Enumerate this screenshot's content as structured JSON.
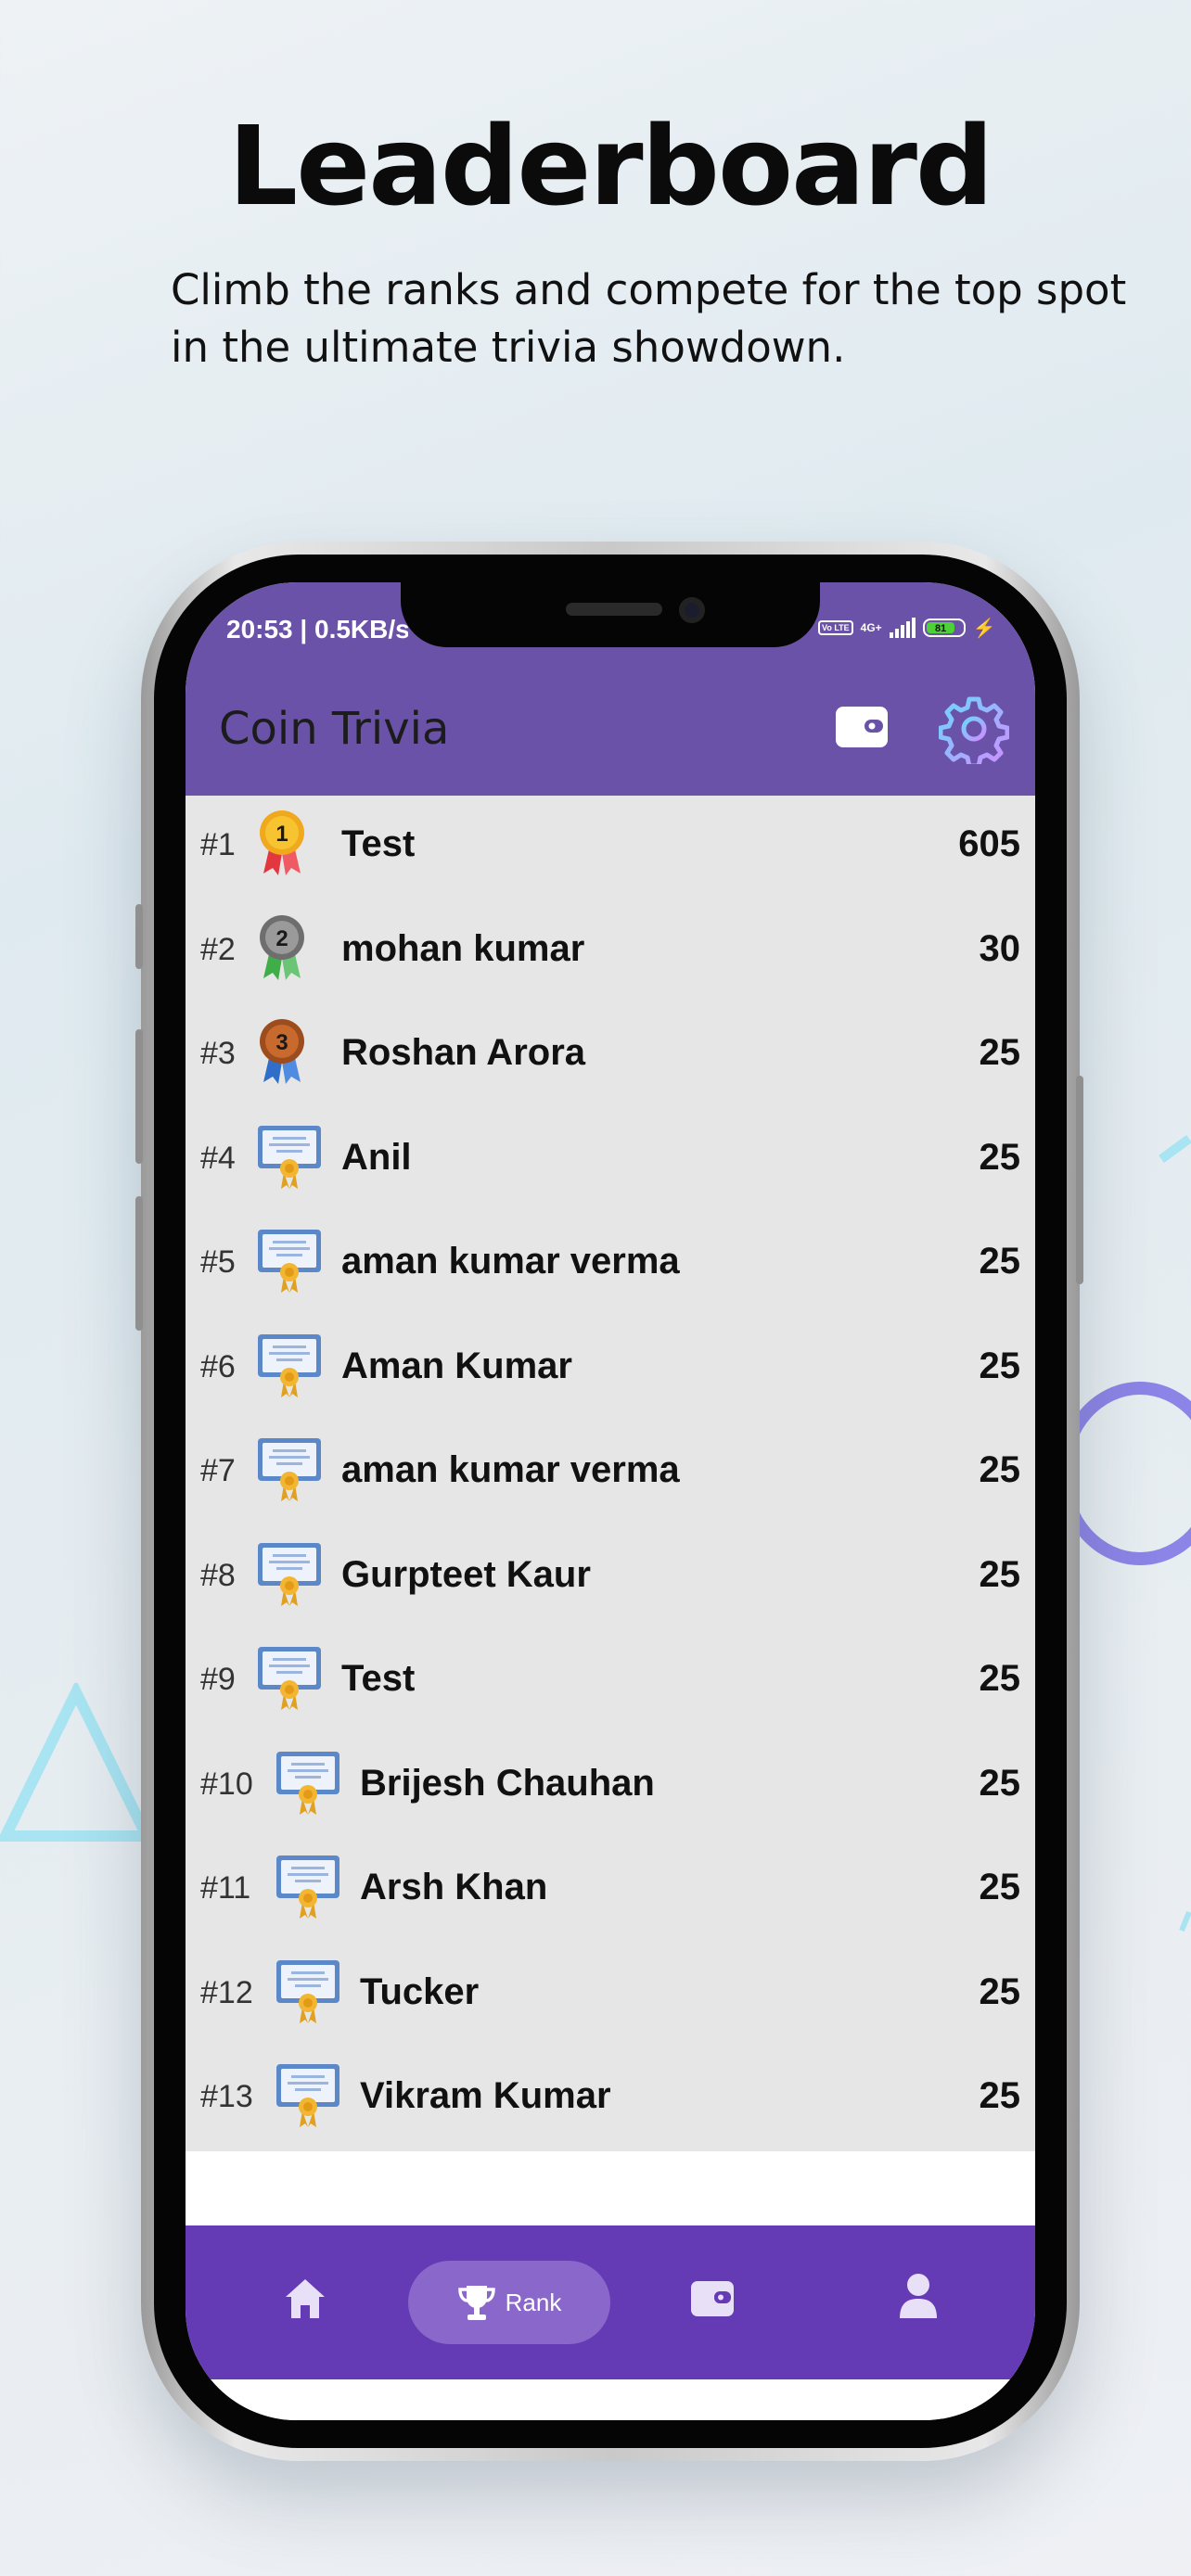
{
  "promo": {
    "headline": "Leaderboard",
    "subheadline": "Climb the ranks and compete for the top spot in the ultimate trivia showdown."
  },
  "status_bar": {
    "time": "20:53 | 0.5KB/s",
    "network_badge": "Vo LTE",
    "network_type": "4G+",
    "battery": "81"
  },
  "app_bar": {
    "title": "Coin Trivia",
    "wallet_icon": "wallet-icon",
    "settings_icon": "gear-icon"
  },
  "leaderboard": [
    {
      "rank": "#1",
      "name": "Test",
      "score": "605",
      "badge": "gold-medal"
    },
    {
      "rank": "#2",
      "name": "mohan kumar",
      "score": "30",
      "badge": "silver-medal"
    },
    {
      "rank": "#3",
      "name": "Roshan Arora",
      "score": "25",
      "badge": "bronze-medal"
    },
    {
      "rank": "#4",
      "name": "Anil",
      "score": "25",
      "badge": "certificate"
    },
    {
      "rank": "#5",
      "name": "aman kumar verma",
      "score": "25",
      "badge": "certificate"
    },
    {
      "rank": "#6",
      "name": "Aman Kumar",
      "score": "25",
      "badge": "certificate"
    },
    {
      "rank": "#7",
      "name": "aman kumar verma",
      "score": "25",
      "badge": "certificate"
    },
    {
      "rank": "#8",
      "name": "Gurpteet Kaur",
      "score": "25",
      "badge": "certificate"
    },
    {
      "rank": "#9",
      "name": "Test",
      "score": "25",
      "badge": "certificate"
    },
    {
      "rank": "#10",
      "name": "Brijesh Chauhan",
      "score": "25",
      "badge": "certificate"
    },
    {
      "rank": "#11",
      "name": "Arsh Khan",
      "score": "25",
      "badge": "certificate"
    },
    {
      "rank": "#12",
      "name": "Tucker",
      "score": "25",
      "badge": "certificate"
    },
    {
      "rank": "#13",
      "name": "Vikram Kumar",
      "score": "25",
      "badge": "certificate"
    }
  ],
  "bottom_nav": {
    "active": "rank",
    "items": [
      {
        "id": "home",
        "icon": "home-icon",
        "label": ""
      },
      {
        "id": "rank",
        "icon": "trophy-icon",
        "label": "Rank"
      },
      {
        "id": "wallet",
        "icon": "wallet-icon",
        "label": ""
      },
      {
        "id": "profile",
        "icon": "user-icon",
        "label": ""
      }
    ]
  },
  "colors": {
    "app_bar": "#6a52a8",
    "bottom_nav": "#643ab5",
    "active_pill": "#8a67cb",
    "list_background": "#e6e6e6"
  }
}
